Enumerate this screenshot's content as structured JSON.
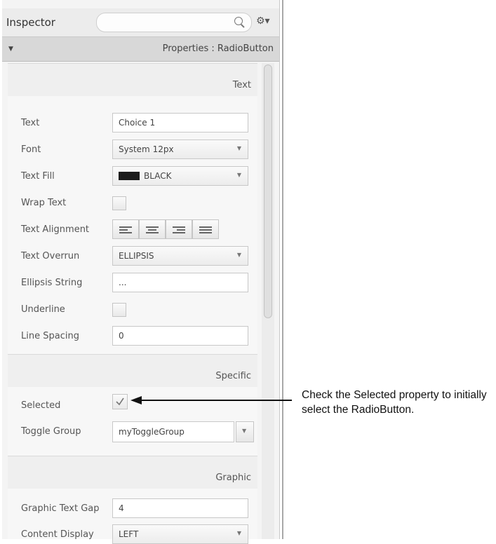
{
  "inspector": {
    "title": "Inspector",
    "search_placeholder": "",
    "section_header": "Properties : RadioButton"
  },
  "sections": {
    "text": "Text",
    "specific": "Specific",
    "graphic": "Graphic"
  },
  "properties": {
    "text_label": "Text",
    "text_value": "Choice 1",
    "font_label": "Font",
    "font_value": "System 12px",
    "text_fill_label": "Text Fill",
    "text_fill_value": "BLACK",
    "text_fill_color": "#1c1c1c",
    "wrap_text_label": "Wrap Text",
    "wrap_text_checked": false,
    "text_alignment_label": "Text Alignment",
    "text_alignment_options": [
      "left",
      "center",
      "right",
      "justify"
    ],
    "text_overrun_label": "Text Overrun",
    "text_overrun_value": "ELLIPSIS",
    "ellipsis_string_label": "Ellipsis String",
    "ellipsis_string_value": "...",
    "underline_label": "Underline",
    "underline_checked": false,
    "line_spacing_label": "Line Spacing",
    "line_spacing_value": "0",
    "selected_label": "Selected",
    "selected_checked": true,
    "toggle_group_label": "Toggle Group",
    "toggle_group_value": "myToggleGroup",
    "graphic_text_gap_label": "Graphic Text Gap",
    "graphic_text_gap_value": "4",
    "content_display_label": "Content Display",
    "content_display_value": "LEFT"
  },
  "callout": {
    "text": "Check the Selected property to initially select the RadioButton."
  }
}
